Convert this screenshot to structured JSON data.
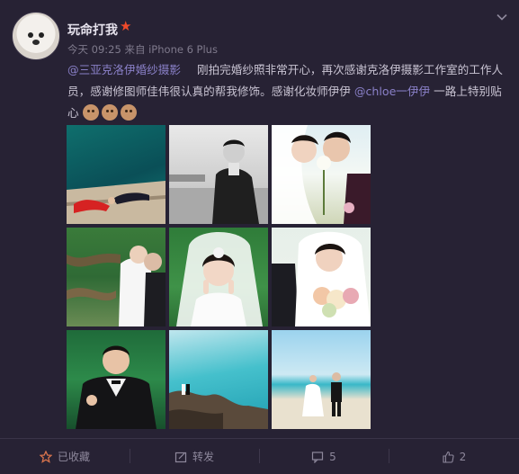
{
  "header": {
    "user_name": "玩命打我",
    "meta_time": "今天 09:25",
    "meta_from_label": "来自",
    "meta_device": "iPhone 6 Plus"
  },
  "post": {
    "mention_studio": "@三亚克洛伊婚纱摄影",
    "text_1": "刚拍完婚纱照非常开心，再次感谢克洛伊摄影工作室的工作人员，感谢修图师佳伟很认真的帮我修饰。感谢化妆师伊伊",
    "mention_makeup": "@chloe一伊伊",
    "text_2": " 一路上特别贴心"
  },
  "photos": [
    {
      "name": "photo-yacht-lying"
    },
    {
      "name": "photo-groom-bw"
    },
    {
      "name": "photo-kiss-rose"
    },
    {
      "name": "photo-forest-couple"
    },
    {
      "name": "photo-bride-smile"
    },
    {
      "name": "photo-bride-bouquet"
    },
    {
      "name": "photo-groom-tropical"
    },
    {
      "name": "photo-sea-rocks"
    },
    {
      "name": "photo-beach-walk"
    }
  ],
  "actions": {
    "favorite": "已收藏",
    "repost": "转发",
    "comments": "5",
    "likes": "2"
  },
  "colors": {
    "background": "#272234",
    "link": "#8a80c8",
    "vip": "#f04a2a"
  }
}
